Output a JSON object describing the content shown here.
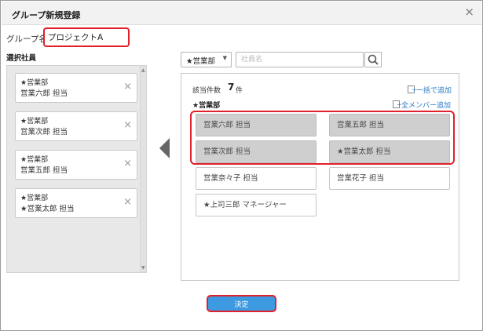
{
  "dialog": {
    "title": "グループ新規登録",
    "close_label": "×"
  },
  "group_name": {
    "label": "グループ名",
    "value": "プロジェクトA"
  },
  "selected": {
    "heading": "選択社員",
    "items": [
      {
        "dept": "★営業部",
        "person": "営業六郎 担当"
      },
      {
        "dept": "★営業部",
        "person": "営業次郎 担当"
      },
      {
        "dept": "★営業部",
        "person": "営業五郎 担当"
      },
      {
        "dept": "★営業部",
        "person": "★営業太郎 担当"
      }
    ],
    "remove_label": "×"
  },
  "filter": {
    "department": "★営業部",
    "search_placeholder": "社員名"
  },
  "results": {
    "count_label": "該当件数",
    "count": "7",
    "count_unit": "件",
    "bulk_add_label": "一括で追加",
    "department": "★営業部",
    "add_all_label": "全メンバー追加",
    "members": [
      {
        "name": "営業六郎 担当",
        "selected": true
      },
      {
        "name": "営業五郎 担当",
        "selected": true
      },
      {
        "name": "営業次郎 担当",
        "selected": true
      },
      {
        "name": "★営業太郎 担当",
        "selected": true
      },
      {
        "name": "営業奈々子 担当",
        "selected": false
      },
      {
        "name": "営業花子 担当",
        "selected": false
      },
      {
        "name": "★上司三郎 マネージャー",
        "selected": false
      }
    ]
  },
  "submit_label": "決定",
  "icons": [
    "close-icon",
    "remove-icon",
    "chevron-down-icon",
    "search-icon",
    "arrow-left-icon",
    "add-document-icon"
  ],
  "colors": {
    "highlight": "#e0202a",
    "primary_button": "#3d9ae0",
    "link": "#2a78c6",
    "selected_card": "#cfcfcf"
  }
}
